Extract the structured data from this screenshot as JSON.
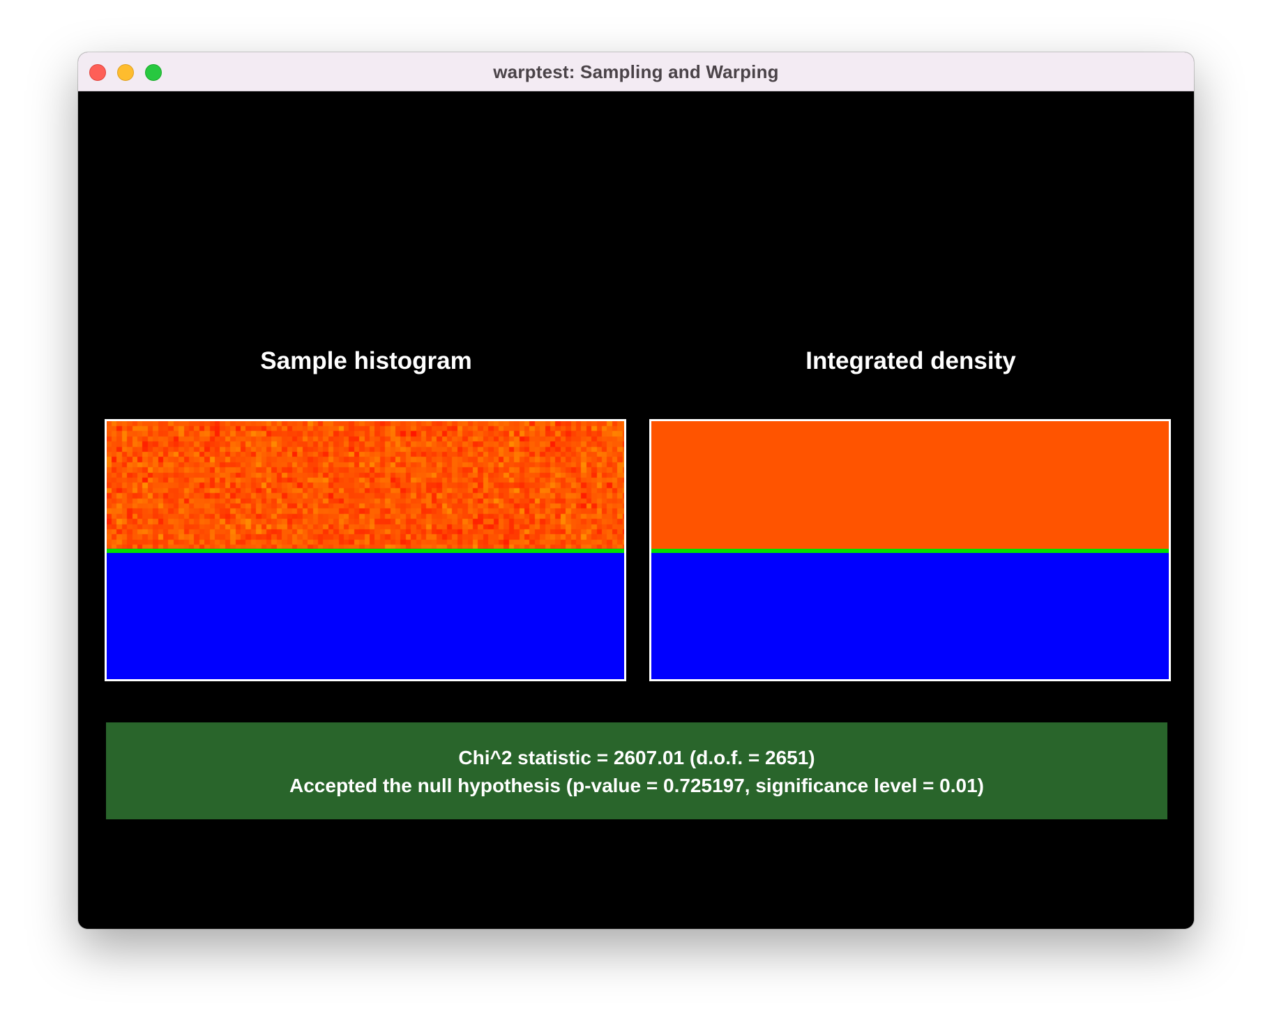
{
  "window": {
    "title": "warptest: Sampling and Warping"
  },
  "panels": {
    "histogram": {
      "title": "Sample histogram"
    },
    "density": {
      "title": "Integrated density"
    }
  },
  "result": {
    "chi2_line": "Chi^2 statistic = 2607.01 (d.o.f. = 2651)",
    "hypothesis_line": "Accepted the null hypothesis (p-value = 0.725197, significance level = 0.01)"
  },
  "colors": {
    "high_density": "#ff5400",
    "zero_density": "#0000ff",
    "boundary": "#00e000",
    "accepted_box": "#29652b"
  },
  "histogram_fraction_nonzero": 0.49
}
